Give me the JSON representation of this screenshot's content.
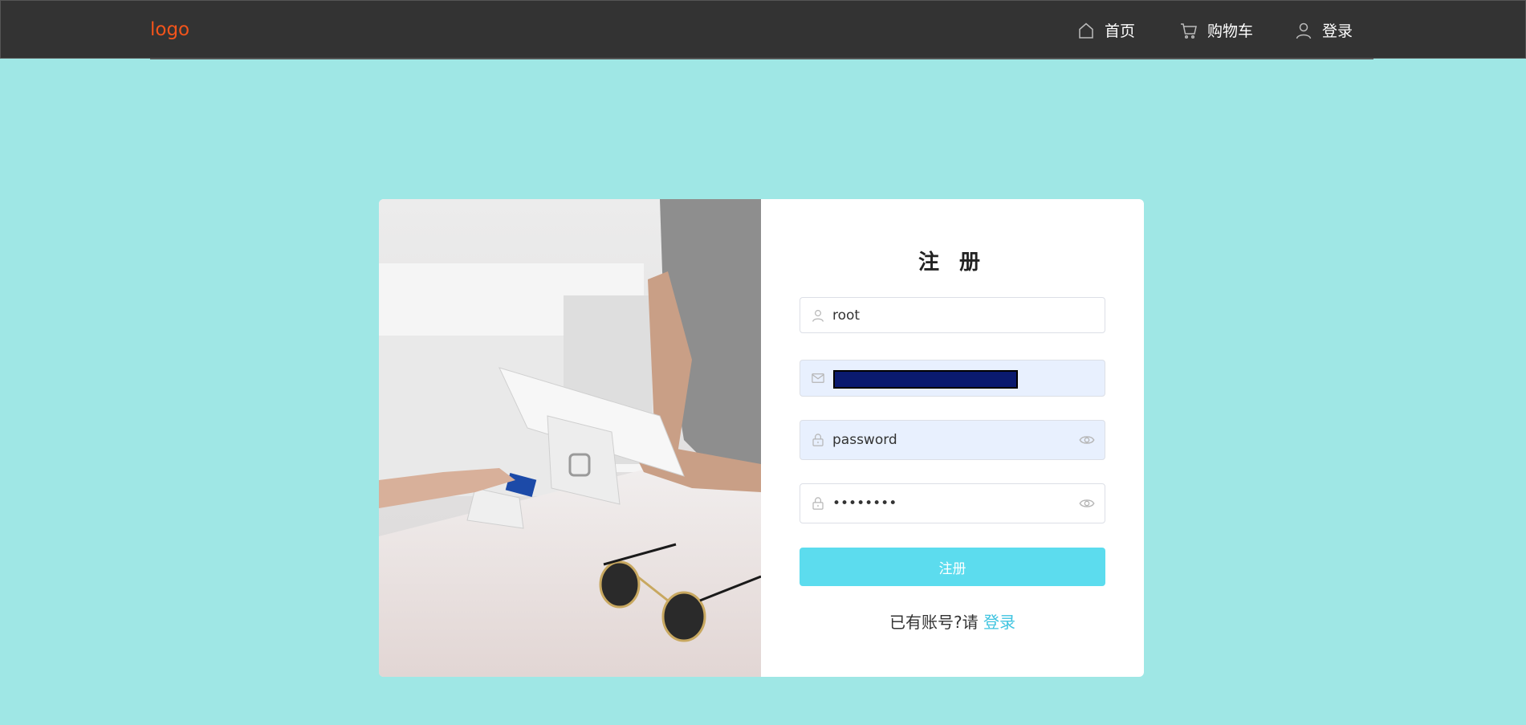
{
  "header": {
    "logo": "logo",
    "nav": {
      "home_label": "首页",
      "cart_label": "购物车",
      "login_label": "登录"
    }
  },
  "register": {
    "title": "注 册",
    "username_value": "root",
    "email_value": "",
    "password_value": "password",
    "confirm_value": "••••••••",
    "submit_label": "注册",
    "has_account_text": "已有账号?请",
    "login_link": "登录"
  },
  "colors": {
    "background": "#9fe7e5",
    "header": "#333333",
    "logo": "#f2541b",
    "button": "#5cdcee",
    "link": "#3fc4e0"
  }
}
